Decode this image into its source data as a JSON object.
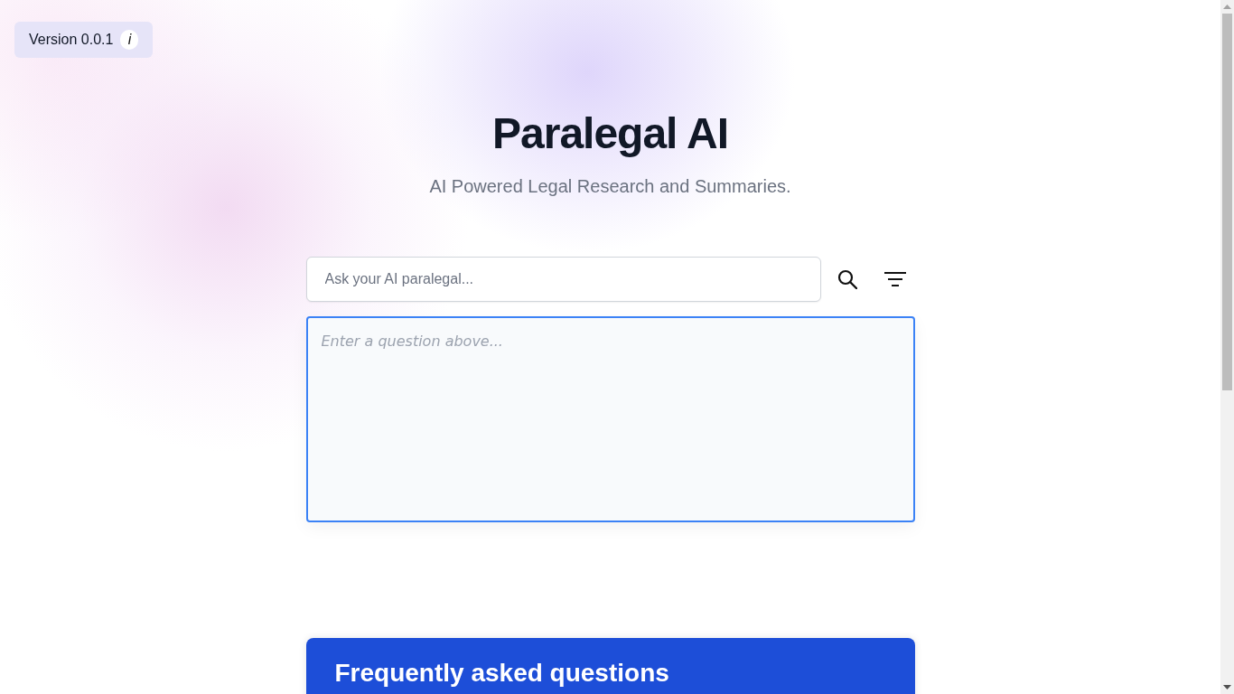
{
  "version_badge": {
    "label": "Version 0.0.1",
    "info": "i"
  },
  "header": {
    "title": "Paralegal AI",
    "subtitle": "AI Powered Legal Research and Summaries."
  },
  "search": {
    "placeholder": "Ask your AI paralegal..."
  },
  "answer": {
    "placeholder": "Enter a question above..."
  },
  "faq": {
    "title": "Frequently asked questions"
  }
}
